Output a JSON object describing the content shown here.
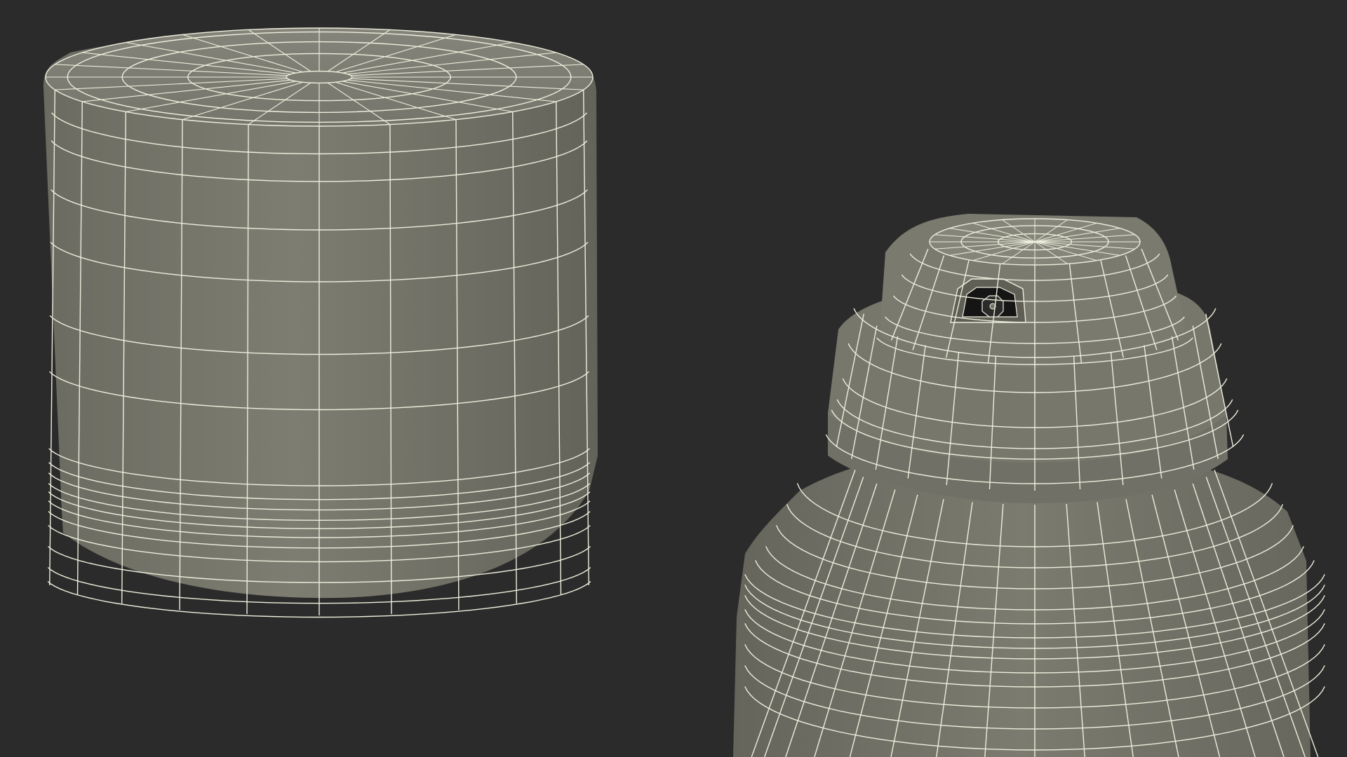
{
  "scene": {
    "background_color": "#2b2b2b",
    "surface_color": "#75756a",
    "surface_shadow_color": "#5e5e55",
    "wire_color": "#eeeedd",
    "nozzle_hole_color": "#151515",
    "objects": [
      {
        "name": "spray-cap",
        "kind": "cylinder-cap",
        "style": "wireframe-on-shaded"
      },
      {
        "name": "spray-can-top",
        "kind": "aerosol-can-with-nozzle",
        "style": "wireframe-on-shaded"
      }
    ]
  }
}
